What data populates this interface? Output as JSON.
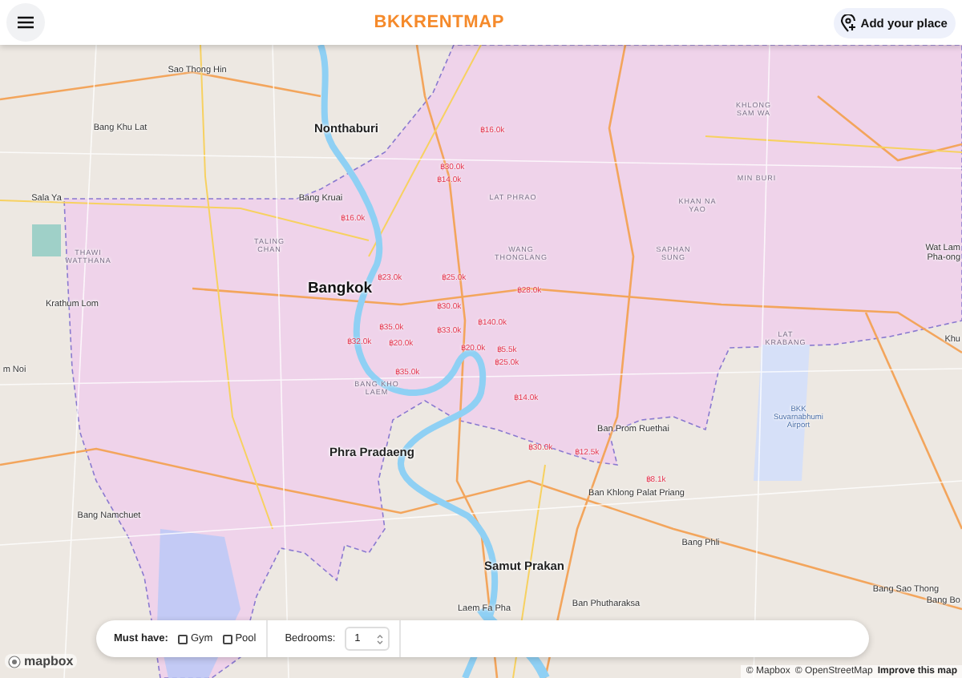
{
  "header": {
    "title": "BKKRENTMAP",
    "add_button": "Add your place"
  },
  "map": {
    "places": [
      {
        "label": "Sao Thong Hin",
        "kind": "town"
      },
      {
        "label": "Bang Khu Lat",
        "kind": "town"
      },
      {
        "label": "Nonthaburi",
        "kind": "city"
      },
      {
        "label": "KHLONG SAM WA",
        "kind": "district"
      },
      {
        "label": "Sala Ya",
        "kind": "town"
      },
      {
        "label": "Bang Kruai",
        "kind": "town"
      },
      {
        "label": "LAT PHRAO",
        "kind": "district"
      },
      {
        "label": "MIN BURI",
        "kind": "district"
      },
      {
        "label": "KHAN NA YAO",
        "kind": "district"
      },
      {
        "label": "TALING CHAN",
        "kind": "district"
      },
      {
        "label": "THAWI WATTHANA",
        "kind": "district"
      },
      {
        "label": "WANG THONGLANG",
        "kind": "district"
      },
      {
        "label": "SAPHAN SUNG",
        "kind": "district"
      },
      {
        "label": "Wat Lam Pha-ong",
        "kind": "town"
      },
      {
        "label": "Bangkok",
        "kind": "capital"
      },
      {
        "label": "Krathum Lom",
        "kind": "town"
      },
      {
        "label": "m Noi",
        "kind": "town"
      },
      {
        "label": "LAT KRABANG",
        "kind": "district"
      },
      {
        "label": "Khu",
        "kind": "town"
      },
      {
        "label": "BANG KHO LAEM",
        "kind": "district"
      },
      {
        "label": "Ban Prom Ruethai",
        "kind": "town"
      },
      {
        "label": "BKK Suvarnabhumi Airport",
        "kind": "airport"
      },
      {
        "label": "Phra Pradaeng",
        "kind": "city"
      },
      {
        "label": "Ban Khlong Palat Priang",
        "kind": "town"
      },
      {
        "label": "Bang Namchuet",
        "kind": "town"
      },
      {
        "label": "Bang Phli",
        "kind": "town"
      },
      {
        "label": "Samut Prakan",
        "kind": "city"
      },
      {
        "label": "Bang Sao Thong",
        "kind": "town"
      },
      {
        "label": "Bang Bo",
        "kind": "town"
      },
      {
        "label": "Laem Fa Pha",
        "kind": "town"
      },
      {
        "label": "Ban Phutharaksa",
        "kind": "town"
      }
    ],
    "prices": [
      "฿16.0k",
      "฿30.0k",
      "฿14.0k",
      "฿16.0k",
      "฿23.0k",
      "฿25.0k",
      "฿28.0k",
      "฿30.0k",
      "฿140.0k",
      "฿35.0k",
      "฿33.0k",
      "฿32.0k",
      "฿20.0k",
      "฿20.0k",
      "฿5.5k",
      "฿25.0k",
      "฿35.0k",
      "฿14.0k",
      "฿30.0k",
      "฿12.5k",
      "฿8.1k"
    ],
    "logo": "mapbox",
    "attribution": [
      "© Mapbox",
      "© OpenStreetMap",
      "Improve this map"
    ]
  },
  "filters": {
    "must_have": "Must have:",
    "options": [
      {
        "label": "Gym",
        "checked": false
      },
      {
        "label": "Pool",
        "checked": false
      }
    ],
    "bedrooms": {
      "label": "Bedrooms:",
      "value": "1"
    }
  }
}
